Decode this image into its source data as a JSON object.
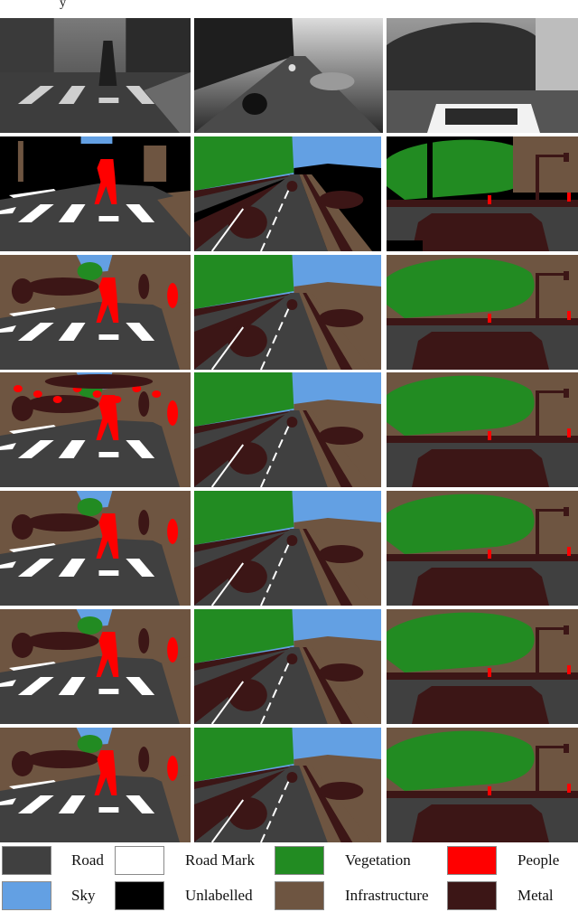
{
  "figure": {
    "stray_mark": "y",
    "columns": [
      "scene-crosswalk",
      "scene-highway",
      "scene-street-car"
    ],
    "rows": [
      {
        "id": "input",
        "kind": "photo"
      },
      {
        "id": "ground-truth",
        "kind": "segmentation"
      },
      {
        "id": "prediction-1",
        "kind": "segmentation"
      },
      {
        "id": "prediction-2",
        "kind": "segmentation"
      },
      {
        "id": "prediction-3",
        "kind": "segmentation"
      },
      {
        "id": "prediction-4",
        "kind": "segmentation"
      },
      {
        "id": "prediction-5",
        "kind": "segmentation"
      }
    ]
  },
  "palette": {
    "road": "#404040",
    "road_mark": "#ffffff",
    "vegetation": "#228b22",
    "people": "#ff0000",
    "sky": "#63a0e3",
    "unlabelled": "#000000",
    "infrastructure": "#6e5541",
    "metal": "#3c1616"
  },
  "legend": {
    "items": [
      {
        "label": "Road",
        "color": "#404040"
      },
      {
        "label": "Road Mark",
        "color": "#ffffff"
      },
      {
        "label": "Vegetation",
        "color": "#228b22"
      },
      {
        "label": "People",
        "color": "#ff0000"
      },
      {
        "label": "Sky",
        "color": "#63a0e3"
      },
      {
        "label": "Unlabelled",
        "color": "#000000"
      },
      {
        "label": "Infrastructure",
        "color": "#6e5541"
      },
      {
        "label": "Metal",
        "color": "#3c1616"
      }
    ]
  }
}
